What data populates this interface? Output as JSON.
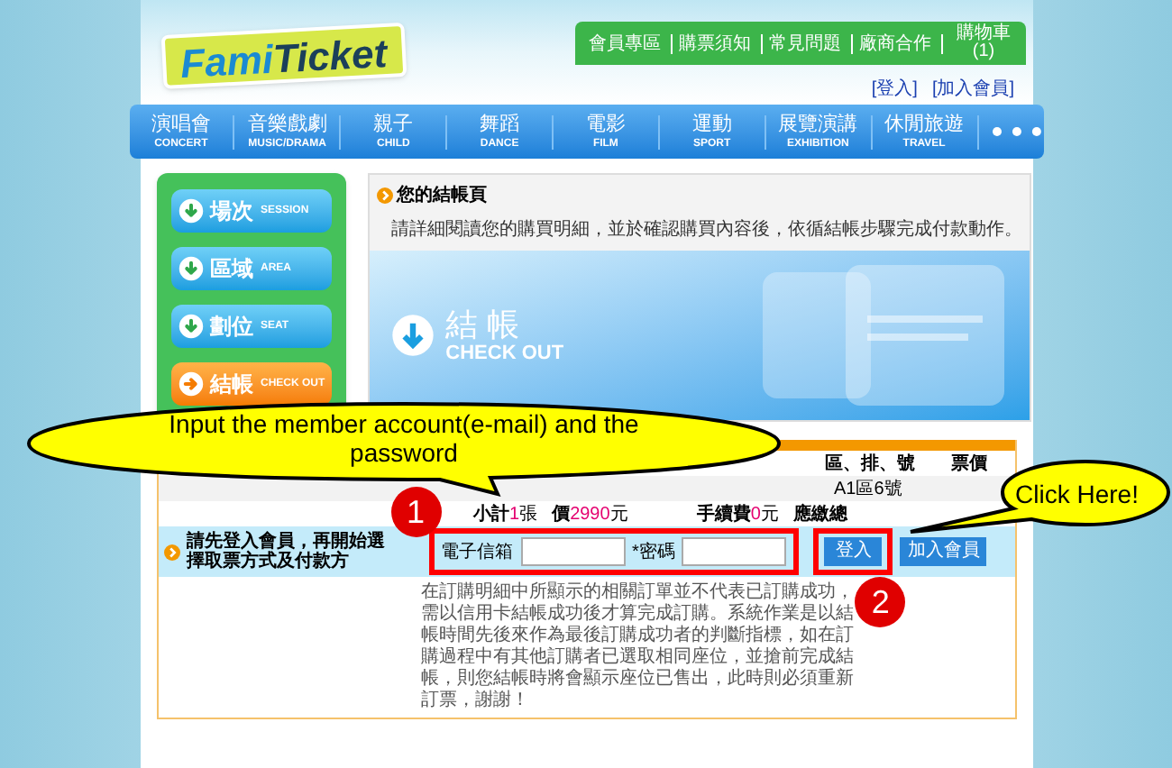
{
  "header": {
    "logo_part_1": "Fami",
    "logo_part_2": "Ticket",
    "top_links": [
      "會員專區",
      "購票須知",
      "常見問題",
      "廠商合作"
    ],
    "cart": "購物車",
    "cart_count": "(1)",
    "account_links": [
      "[登入]",
      "[加入會員]"
    ]
  },
  "nav": [
    {
      "zh": "演唱會",
      "en": "CONCERT"
    },
    {
      "zh": "音樂戲劇",
      "en": "MUSIC/DRAMA"
    },
    {
      "zh": "親子",
      "en": "CHILD"
    },
    {
      "zh": "舞蹈",
      "en": "DANCE"
    },
    {
      "zh": "電影",
      "en": "FILM"
    },
    {
      "zh": "運動",
      "en": "SPORT"
    },
    {
      "zh": "展覽演講",
      "en": "EXHIBITION"
    },
    {
      "zh": "休閒旅遊",
      "en": "TRAVEL"
    }
  ],
  "steps": [
    {
      "zh": "場次",
      "en": "SESSION",
      "selected": false
    },
    {
      "zh": "區域",
      "en": "AREA",
      "selected": false
    },
    {
      "zh": "劃位",
      "en": "SEAT",
      "selected": false
    },
    {
      "zh": "結帳",
      "en": "CHECK OUT",
      "selected": true
    }
  ],
  "checkout_panel": {
    "title": "您的結帳頁",
    "description": "請詳細閱讀您的購買明細，並於確認購買內容後，依循結帳步驟完成付款動作。",
    "banner_zh": "結 帳",
    "banner_en": "CHECK OUT"
  },
  "order": {
    "columns": [
      "區、排、號",
      "票價"
    ],
    "rows": [
      [
        "A1區6號"
      ]
    ],
    "totals": [
      {
        "label": "小計",
        "value": "1",
        "unit": "張"
      },
      {
        "label": "價",
        "value": "2990",
        "unit": "元"
      },
      {
        "label": "手續費",
        "value": "0",
        "unit": "元"
      },
      {
        "label": "應繳總"
      }
    ]
  },
  "login_bar": {
    "message": "請先登入會員，再開始選擇取票方式及付款方",
    "email_label": "電子信箱",
    "password_label": "*密碼",
    "login_button": "登入",
    "join_button": "加入會員"
  },
  "notes": "在訂購明細中所顯示的相關訂單並不代表已訂購成功，需以信用卡結帳成功後才算完成訂購。系統作業是以結帳時間先後來作為最後訂購成功者的判斷指標，如在訂購過程中有其他訂購者已選取相同座位，並搶前完成結帳，則您結帳時將會顯示座位已售出，此時則必須重新訂票，謝謝！",
  "callouts": [
    {
      "number": "1",
      "text": "Input the member account(e-mail) and the password"
    },
    {
      "number": "2",
      "text": "Click Here!"
    }
  ]
}
